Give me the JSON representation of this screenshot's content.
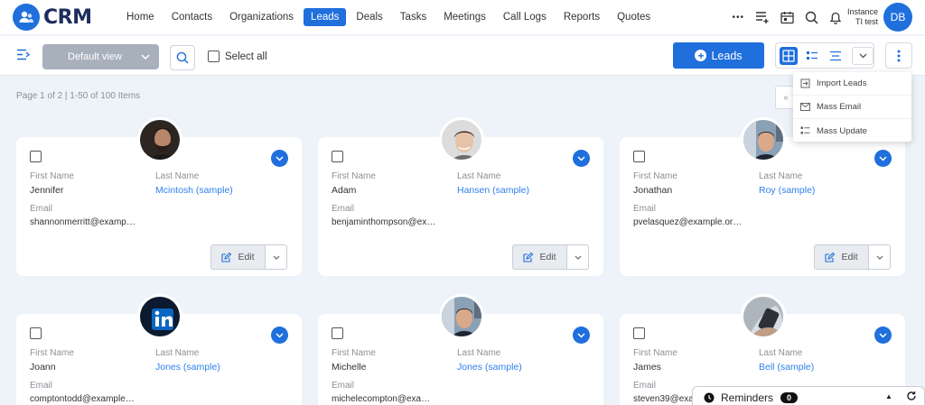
{
  "app": {
    "logo_text": "CRM"
  },
  "nav": {
    "items": [
      {
        "label": "Home",
        "active": false
      },
      {
        "label": "Contacts",
        "active": false
      },
      {
        "label": "Organizations",
        "active": false
      },
      {
        "label": "Leads",
        "active": true
      },
      {
        "label": "Deals",
        "active": false
      },
      {
        "label": "Tasks",
        "active": false
      },
      {
        "label": "Meetings",
        "active": false
      },
      {
        "label": "Call Logs",
        "active": false
      },
      {
        "label": "Reports",
        "active": false
      },
      {
        "label": "Quotes",
        "active": false
      }
    ],
    "more_label": "•••",
    "instance_line1": "Instance",
    "instance_line2": "TI test",
    "user_initials": "DB"
  },
  "toolbar": {
    "view_label": "Default view",
    "select_all_label": "Select all",
    "add_button_label": "Leads"
  },
  "pager": {
    "text": "Page 1 of 2  |  1-50 of 100 Items"
  },
  "menu": {
    "items": [
      {
        "label": "Import Leads",
        "icon": "import-icon"
      },
      {
        "label": "Mass Email",
        "icon": "mail-icon"
      },
      {
        "label": "Mass Update",
        "icon": "list-update-icon"
      }
    ]
  },
  "labels": {
    "first_name": "First Name",
    "last_name": "Last Name",
    "email": "Email",
    "edit": "Edit"
  },
  "cards": [
    {
      "first": "Jennifer",
      "last": "Mcintosh (sample)",
      "email": "shannonmerritt@examp…",
      "photo": "man-beard"
    },
    {
      "first": "Adam",
      "last": "Hansen (sample)",
      "email": "benjaminthompson@ex…",
      "photo": "boy-smiling"
    },
    {
      "first": "Jonathan",
      "last": "Roy (sample)",
      "email": "pvelasquez@example.or…",
      "photo": "man-room"
    },
    {
      "first": "Joann",
      "last": "Jones (sample)",
      "email": "comptontodd@example…",
      "photo": "linkedin-logo"
    },
    {
      "first": "Michelle",
      "last": "Jones (sample)",
      "email": "michelecompton@exa…",
      "photo": "man-room"
    },
    {
      "first": "James",
      "last": "Bell (sample)",
      "email": "steven39@exa…",
      "photo": "hand-phone"
    }
  ],
  "reminders": {
    "label": "Reminders",
    "count": "0"
  }
}
